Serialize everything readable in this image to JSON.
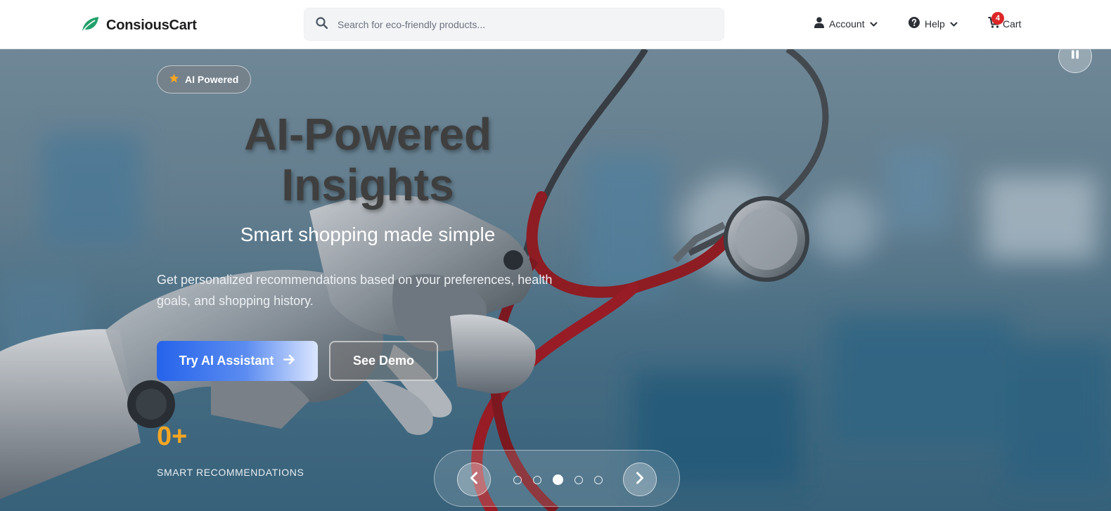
{
  "header": {
    "brand": "ConsiousCart",
    "search_placeholder": "Search for eco-friendly products...",
    "account_label": "Account",
    "help_label": "Help",
    "cart_label": "Cart",
    "cart_count": "4"
  },
  "hero": {
    "badge_label": "AI Powered",
    "title_line1": "AI-Powered",
    "title_line2": "Insights",
    "subtitle": "Smart shopping made simple",
    "description": "Get personalized recommendations based on your preferences, health goals, and shopping history.",
    "primary_cta": "Try AI Assistant",
    "secondary_cta": "See Demo",
    "stat_value": "0+",
    "stat_label": "SMART RECOMMENDATIONS"
  },
  "carousel": {
    "slide_count": 5,
    "active_index": 2
  },
  "colors": {
    "brand_leaf": "#22a06b",
    "primary_button": "#2563eb",
    "accent_stat": "#f5a623",
    "cart_badge": "#dc2626"
  },
  "icons": {
    "logo": "leaf-icon",
    "search": "search-icon",
    "account": "user-icon",
    "help": "question-circle-icon",
    "cart": "cart-icon",
    "badge": "star-icon",
    "cta": "arrow-right-icon",
    "prev": "chevron-left-icon",
    "next": "chevron-right-icon",
    "pause": "pause-icon"
  }
}
